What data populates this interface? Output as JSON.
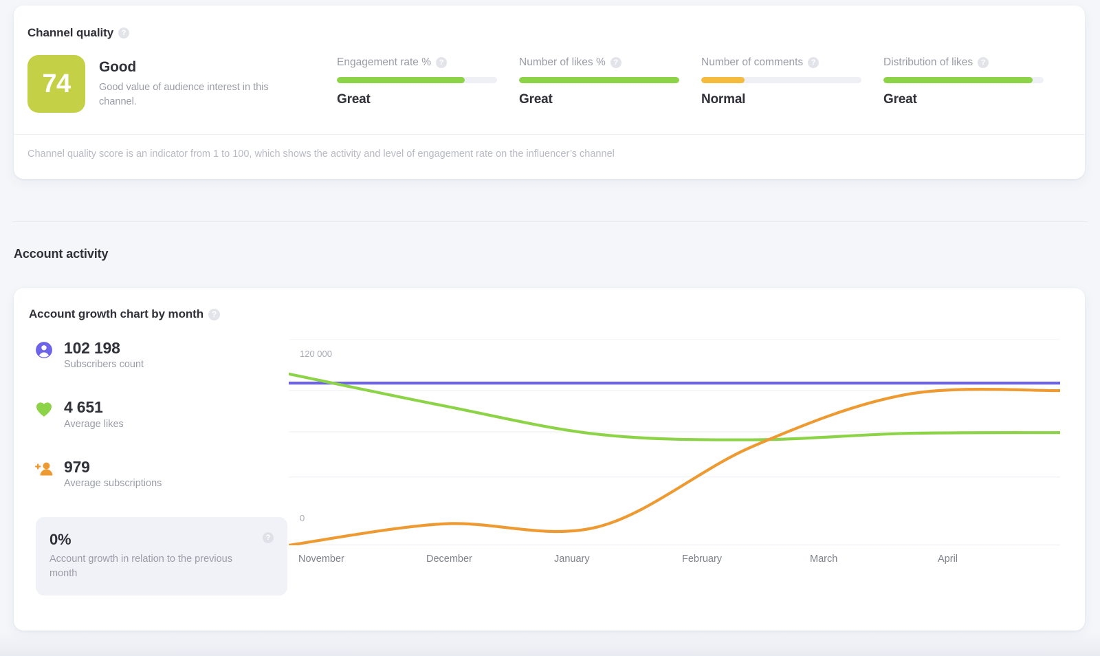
{
  "quality": {
    "heading": "Channel quality",
    "help_glyph": "?",
    "score": "74",
    "score_color": "#c4d147",
    "score_label": "Good",
    "score_desc": "Good value of audience interest in this channel.",
    "note": "Channel quality score is an indicator from 1 to 100, which shows the activity and level of engagement rate on the influencer’s channel",
    "metrics": [
      {
        "title": "Engagement rate %",
        "value": "Great",
        "fill_pct": 80,
        "color": "#8dd348"
      },
      {
        "title": "Number of likes %",
        "value": "Great",
        "fill_pct": 100,
        "color": "#8dd348"
      },
      {
        "title": "Number of comments",
        "value": "Normal",
        "fill_pct": 27,
        "color": "#f5bb3f"
      },
      {
        "title": "Distribution of likes",
        "value": "Great",
        "fill_pct": 93,
        "color": "#8dd348"
      }
    ]
  },
  "activity": {
    "section_title": "Account activity",
    "chart_title": "Account growth chart by month",
    "stats": [
      {
        "icon": "subscriber-icon",
        "number": "102 198",
        "label": "Subscribers count",
        "color": "#6c63e8"
      },
      {
        "icon": "heart-icon",
        "number": "4 651",
        "label": "Average likes",
        "color": "#8dd348"
      },
      {
        "icon": "add-person-icon",
        "number": "979",
        "label": "Average subscriptions",
        "color": "#ee9a33"
      }
    ],
    "growth": {
      "value": "0%",
      "desc": "Account growth in relation to the previous month",
      "help_glyph": "?"
    }
  },
  "chart_data": {
    "type": "line",
    "title": "Account growth chart by month",
    "xlabel": "",
    "ylabel": "",
    "categories": [
      "November",
      "December",
      "January",
      "February",
      "March",
      "April"
    ],
    "ytick_labels": [
      "120 000",
      "0"
    ],
    "ylim": [
      0,
      130000
    ],
    "grid": true,
    "gridlines_y": [
      130000,
      97500,
      71500,
      43000,
      0
    ],
    "legend": "none",
    "series": [
      {
        "name": "Subscribers count",
        "color": "#6c63e8",
        "values": [
          102198,
          102198,
          102198,
          102198,
          102198,
          102198
        ]
      },
      {
        "name": "Average likes",
        "color": "#8dd348",
        "values": [
          108000,
          88000,
          70000,
          66500,
          70500,
          71000
        ]
      },
      {
        "name": "Average subscriptions",
        "color": "#ee9a33",
        "values": [
          0,
          13500,
          11500,
          62000,
          95000,
          97500
        ]
      }
    ]
  }
}
